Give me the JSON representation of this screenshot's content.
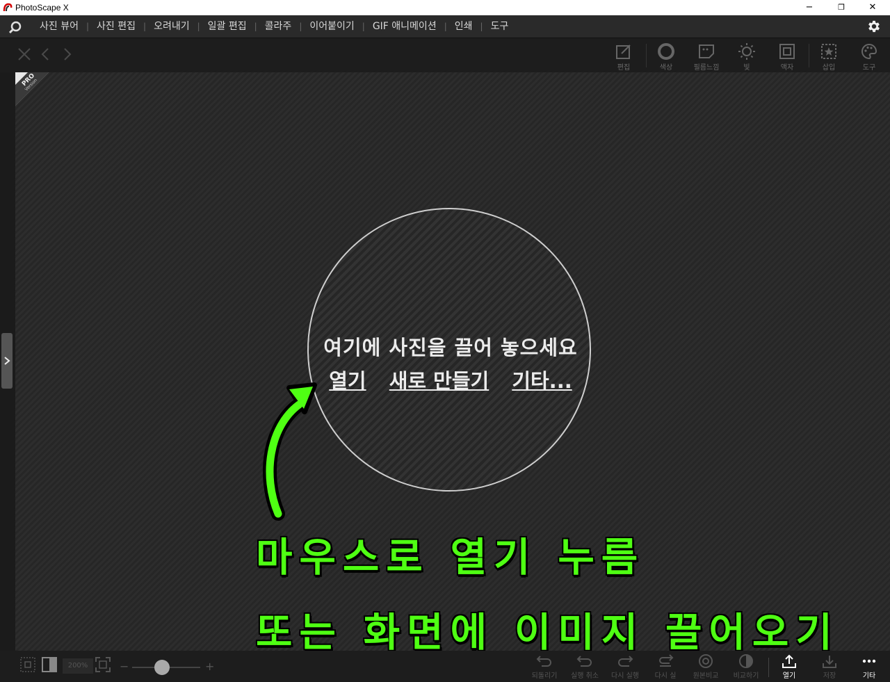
{
  "window": {
    "title": "PhotoScape X",
    "minimize": "−",
    "restore": "❐",
    "close": "✕"
  },
  "menu": {
    "items": [
      "사진 뷰어",
      "사진 편집",
      "오려내기",
      "일괄 편집",
      "콜라주",
      "이어붙이기",
      "GIF 애니메이션",
      "인쇄",
      "도구"
    ],
    "separator": "|"
  },
  "toolbar": {
    "tools": [
      "편집",
      "색상",
      "필름느낌",
      "빛",
      "액자",
      "삽입",
      "도구"
    ]
  },
  "badge": {
    "line1": "PRO",
    "line2": "Version"
  },
  "dropzone": {
    "text": "여기에 사진을 끌어 놓으세요",
    "links": [
      "열기",
      "새로 만들기",
      "기타..."
    ]
  },
  "annotation": {
    "line1": "마우스로 열기 누름",
    "line2": "또는 화면에 이미지 끌어오기",
    "color": "#4fff13"
  },
  "bottombar": {
    "zoom": "200%",
    "minus": "−",
    "plus": "+",
    "tools": [
      "되돌리기",
      "실행 취소",
      "다시 실행",
      "다시 실",
      "원본비교",
      "비교하기",
      "열기",
      "저장",
      "기타"
    ]
  }
}
